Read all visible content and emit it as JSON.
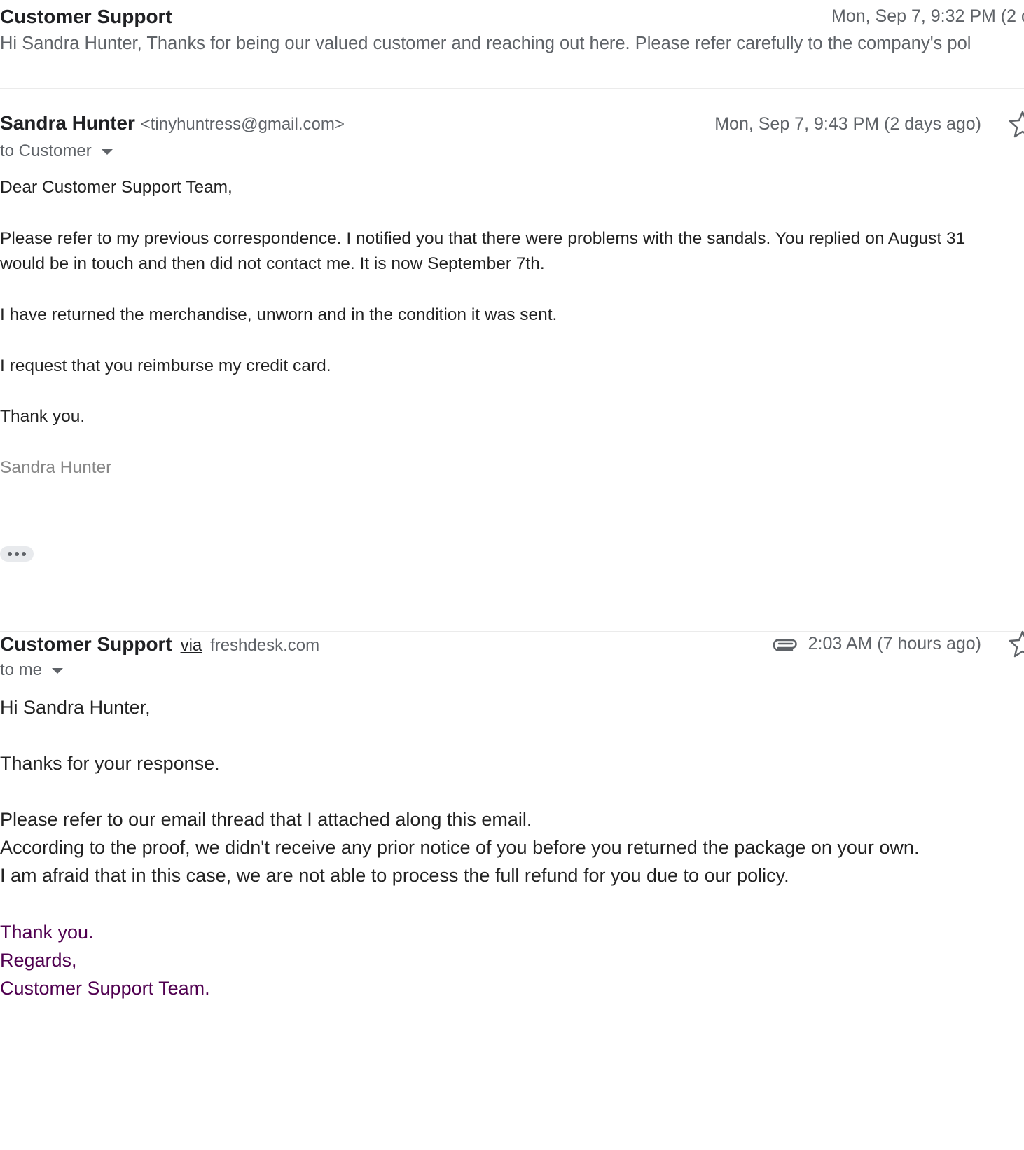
{
  "collapsed_message": {
    "sender": "Customer Support",
    "date": "Mon, Sep 7, 9:32 PM (2 d",
    "snippet": "Hi Sandra Hunter, Thanks for being our valued customer and reaching out here. Please refer carefully to the company's pol"
  },
  "message_1": {
    "sender_name": "Sandra Hunter",
    "sender_email": "<tinyhuntress@gmail.com>",
    "date": "Mon, Sep 7, 9:43 PM (2 days ago)",
    "recipient": "to Customer",
    "body": [
      "Dear Customer Support Team,",
      "Please refer to my previous correspondence. I notified you that there were problems with the sandals. You replied on August 31",
      "would be in touch and then did not contact me. It is now September 7th.",
      "I have returned the merchandise, unworn and in the condition it was sent.",
      "I request that you reimburse my credit card.",
      "Thank you."
    ],
    "signature": "Sandra Hunter",
    "trimmed_content_icon": "ellipsis-icon"
  },
  "message_2": {
    "sender_name": "Customer Support",
    "via_label": "via",
    "via_domain": "freshdesk.com",
    "date": "2:03 AM (7 hours ago)",
    "recipient": "to me",
    "has_attachment_icon": "paperclip-icon",
    "body": [
      "Hi Sandra Hunter,",
      "Thanks for your response.",
      "Please refer to our email thread that I attached along this email.",
      "According to the proof, we didn't receive any prior notice of you before you returned the package on your own.",
      "I am afraid that in this case, we are not able to process the full refund for you due to our policy."
    ],
    "signature": [
      "Thank you.",
      "Regards,",
      "Customer Support Team."
    ]
  },
  "colors": {
    "primary_text": "#202124",
    "secondary_text": "#5f6368",
    "signature_grey": "#888888",
    "signature_purple": "#500050",
    "divider": "#ebebeb"
  }
}
